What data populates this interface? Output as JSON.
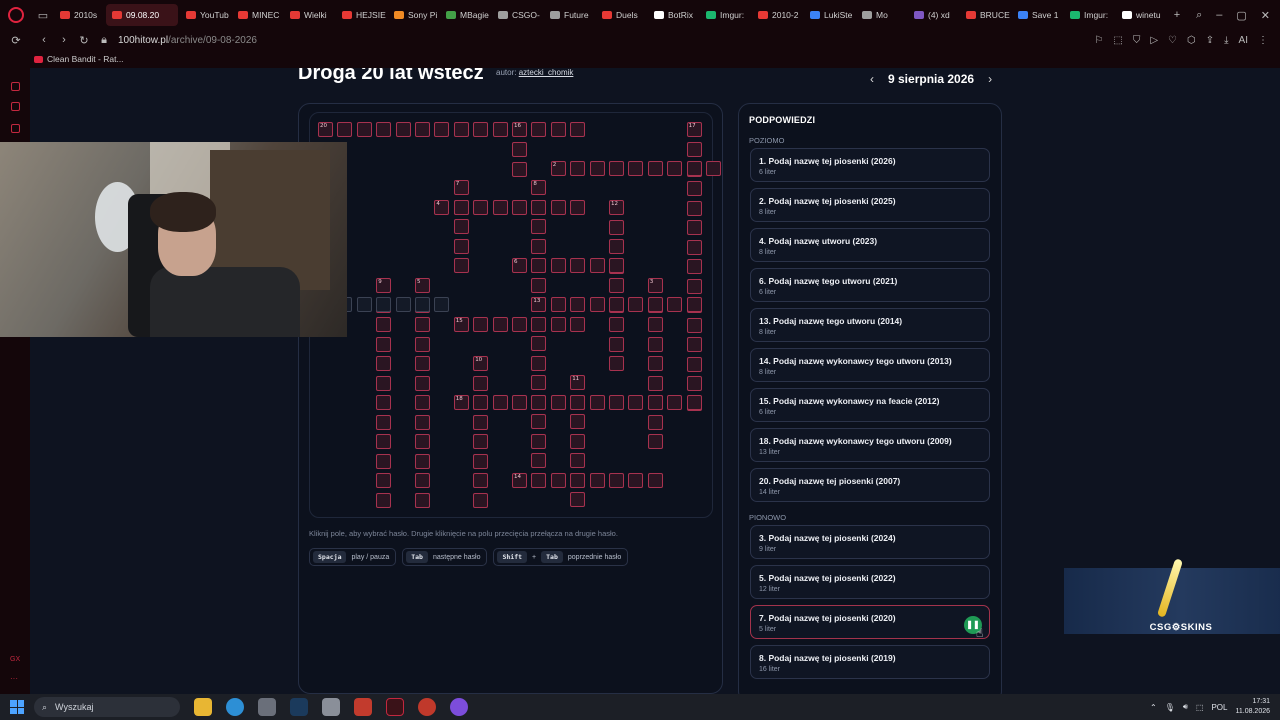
{
  "browser": {
    "tabs": [
      {
        "label": "2010s",
        "color": "#e53935",
        "active": false
      },
      {
        "label": "09.08.20",
        "color": "#e53935",
        "active": true
      },
      {
        "label": "YouTub",
        "color": "#e53935",
        "active": false
      },
      {
        "label": "MINEC",
        "color": "#e53935",
        "active": false
      },
      {
        "label": "Wielki",
        "color": "#e53935",
        "active": false
      },
      {
        "label": "HEJSIE",
        "color": "#e53935",
        "active": false
      },
      {
        "label": "Sony Pi",
        "color": "#f08a24",
        "active": false
      },
      {
        "label": "MBagie",
        "color": "#43a047",
        "active": false
      },
      {
        "label": "CSGO-",
        "color": "#9e9e9e",
        "active": false
      },
      {
        "label": "Future",
        "color": "#9e9e9e",
        "active": false
      },
      {
        "label": "Duels",
        "color": "#e53935",
        "active": false
      },
      {
        "label": "BotRix",
        "color": "#ffffff",
        "active": false
      },
      {
        "label": "Imgur:",
        "color": "#1bb76e",
        "active": false
      },
      {
        "label": "2010-2",
        "color": "#e53935",
        "active": false
      },
      {
        "label": "LukiSte",
        "color": "#3b82f6",
        "active": false
      },
      {
        "label": "Mo",
        "color": "#9e9e9e",
        "active": false
      },
      {
        "label": "(4) xd",
        "color": "#7e57c2",
        "active": false
      },
      {
        "label": "BRUCE",
        "color": "#e53935",
        "active": false
      },
      {
        "label": "Save 1",
        "color": "#3b82f6",
        "active": false
      },
      {
        "label": "Imgur:",
        "color": "#1bb76e",
        "active": false
      },
      {
        "label": "winetu",
        "color": "#ffffff",
        "active": false
      }
    ],
    "url_host": "100hitow.pl",
    "url_path": "/archive/09-08-2026",
    "bookmark": "Clean Bandit - Rat...",
    "ai_label": "AI"
  },
  "page": {
    "title": "Droga 20 lat wstecz",
    "author_prefix": "autor:",
    "author": "aztecki_chomik",
    "date": "9 sierpnia 2026",
    "prev_icon": "chevron-left-icon",
    "next_icon": "chevron-right-icon",
    "instructions": "Kliknij pole, aby wybrać hasło. Drugie kliknięcie na polu przecięcia przełącza na drugie hasło.",
    "keys": [
      {
        "keys": [
          "Spacja"
        ],
        "label": "play / pauza"
      },
      {
        "keys": [
          "Tab"
        ],
        "label": "następne hasło"
      },
      {
        "keys": [
          "Shift",
          "Tab"
        ],
        "label": "poprzednie hasło",
        "joiner": "+"
      }
    ]
  },
  "hints": {
    "title": "PODPOWIEDZI",
    "across_label": "POZIOMO",
    "down_label": "PIONOWO",
    "across": [
      {
        "text": "1. Podaj nazwę tej piosenki (2026)",
        "len": "6 liter"
      },
      {
        "text": "2. Podaj nazwę tej piosenki (2025)",
        "len": "8 liter"
      },
      {
        "text": "4. Podaj nazwę utworu (2023)",
        "len": "8 liter"
      },
      {
        "text": "6. Podaj nazwę tego utworu (2021)",
        "len": "6 liter"
      },
      {
        "text": "13. Podaj nazwę tego utworu (2014)",
        "len": "8 liter"
      },
      {
        "text": "14. Podaj nazwę wykonawcy tego utworu (2013)",
        "len": "8 liter"
      },
      {
        "text": "15. Podaj nazwę wykonawcy na feacie (2012)",
        "len": "6 liter"
      },
      {
        "text": "18. Podaj nazwę wykonawcy tego utworu (2009)",
        "len": "13 liter"
      },
      {
        "text": "20. Podaj nazwę tej piosenki (2007)",
        "len": "14 liter"
      }
    ],
    "down": [
      {
        "text": "3. Podaj nazwę tej piosenki (2024)",
        "len": "9 liter"
      },
      {
        "text": "5. Podaj nazwę tej piosenki (2022)",
        "len": "12 liter"
      },
      {
        "text": "7. Podaj nazwę tej piosenki (2020)",
        "len": "5 liter",
        "active": true
      },
      {
        "text": "8. Podaj nazwę tej piosenki (2019)",
        "len": "16 liter"
      }
    ],
    "play_symbol": "❚❚"
  },
  "ad": {
    "brand": "CSG⚙SKINS"
  },
  "taskbar": {
    "search": "Wyszukaj",
    "lang": "POL",
    "time": "17:31",
    "date": "11.08.2026"
  },
  "colors": {
    "accent": "#c2283f",
    "cell_border": "#a7324f",
    "play": "#1f9a55"
  }
}
